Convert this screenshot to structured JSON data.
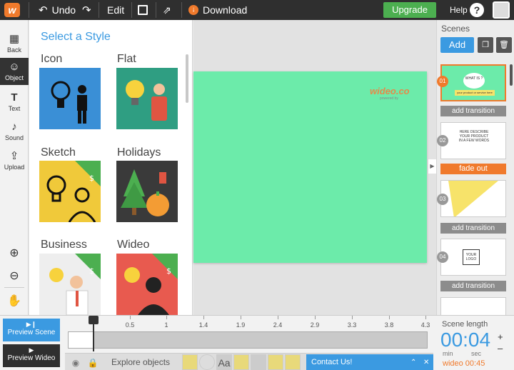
{
  "topbar": {
    "logo_text": "w",
    "undo_label": "Undo",
    "edit_label": "Edit",
    "download_label": "Download",
    "upgrade_label": "Upgrade",
    "help_label": "Help"
  },
  "tools": {
    "back": "Back",
    "object": "Object",
    "text": "Text",
    "sound": "Sound",
    "upload": "Upload"
  },
  "style_panel": {
    "title": "Select a Style",
    "styles": [
      {
        "label": "Icon",
        "color": "#3a8fd6"
      },
      {
        "label": "Flat",
        "color": "#2f9e82"
      },
      {
        "label": "Sketch",
        "color": "#f0c93a"
      },
      {
        "label": "Holidays",
        "color": "#3a3a3a"
      },
      {
        "label": "Business",
        "color": "#eeeeee"
      },
      {
        "label": "Wideo",
        "color": "#e85a4f"
      }
    ]
  },
  "canvas": {
    "watermark": "wideo.co",
    "watermark_sub": "powered by"
  },
  "scenes": {
    "title": "Scenes",
    "add_label": "Add",
    "items": [
      {
        "num": "01",
        "text_a": "WHAT IS ?",
        "text_b": "your product or service here"
      },
      {
        "num": "02",
        "text_a": "HERE DESCRIBE YOUR PRODUCT IN A FEW WORDS",
        "text_b": ""
      },
      {
        "num": "03",
        "text_a": "",
        "text_b": ""
      },
      {
        "num": "04",
        "text_a": "YOUR LOGO",
        "text_b": ""
      }
    ],
    "transitions": [
      "add transition",
      "fade out",
      "add transition",
      "add transition"
    ]
  },
  "bottom": {
    "preview_scene": "Preview Scene",
    "preview_wideo": "Preview Wideo",
    "ticks": [
      "0.5",
      "1",
      "1.4",
      "1.9",
      "2.4",
      "2.9",
      "3.3",
      "3.8",
      "4.3"
    ],
    "explore_label": "Explore objects",
    "contact_label": "Contact Us!",
    "scene_length_label": "Scene length",
    "scene_length_value": "00:04",
    "min_label": "min",
    "sec_label": "sec",
    "wideo_total": "wideo 00:45",
    "aa_label": "Aa"
  }
}
